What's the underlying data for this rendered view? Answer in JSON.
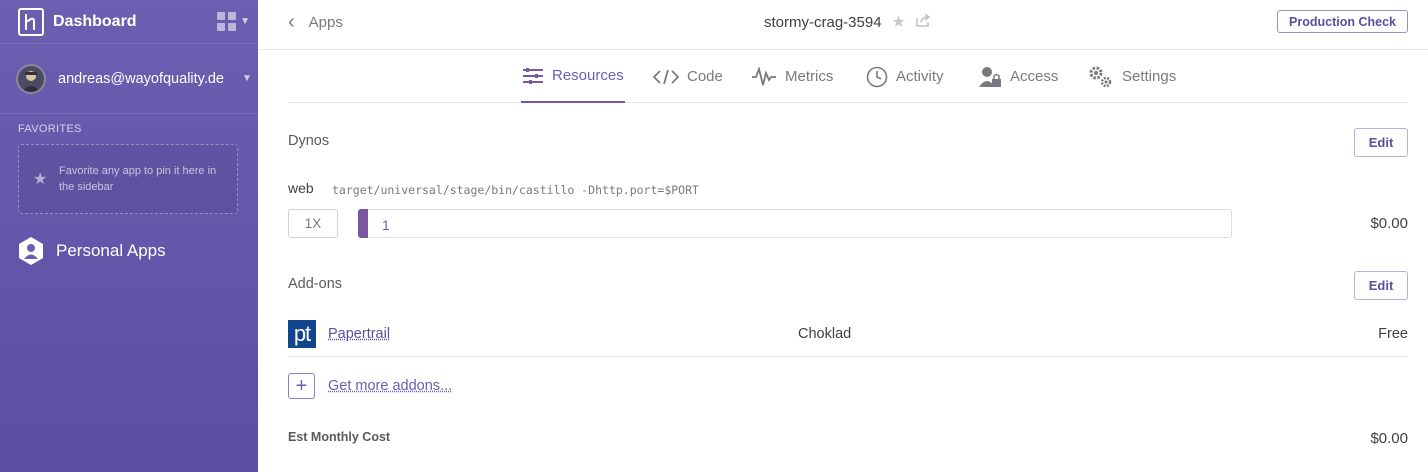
{
  "sidebar": {
    "title": "Dashboard",
    "user_email": "andreas@wayofquality.de",
    "favorites_label": "FAVORITES",
    "favorites_hint": "Favorite any app to pin it here in the sidebar",
    "personal_apps": "Personal Apps"
  },
  "topbar": {
    "back_label": "Apps",
    "app_name": "stormy-crag-3594",
    "production_check": "Production Check"
  },
  "tabs": [
    {
      "label": "Resources",
      "icon": "resources-icon",
      "active": true
    },
    {
      "label": "Code",
      "icon": "code-icon",
      "active": false
    },
    {
      "label": "Metrics",
      "icon": "metrics-icon",
      "active": false
    },
    {
      "label": "Activity",
      "icon": "activity-icon",
      "active": false
    },
    {
      "label": "Access",
      "icon": "access-icon",
      "active": false
    },
    {
      "label": "Settings",
      "icon": "settings-icon",
      "active": false
    }
  ],
  "dynos": {
    "title": "Dynos",
    "edit_label": "Edit",
    "items": [
      {
        "type": "web",
        "command": "target/universal/stage/bin/castillo -Dhttp.port=$PORT",
        "size": "1X",
        "count": "1",
        "cost": "$0.00"
      }
    ]
  },
  "addons": {
    "title": "Add-ons",
    "edit_label": "Edit",
    "items": [
      {
        "logo": "pt",
        "name": "Papertrail",
        "plan": "Choklad",
        "price": "Free"
      }
    ],
    "more_label": "Get more addons..."
  },
  "summary": {
    "label": "Est Monthly Cost",
    "value": "$0.00"
  },
  "colors": {
    "sidebar": "#6a5fb0",
    "accent": "#79589f",
    "papertrail_blue": "#11468f"
  }
}
